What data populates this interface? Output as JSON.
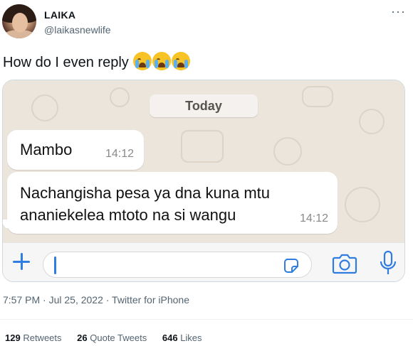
{
  "tweet": {
    "display_name": "LAIKA",
    "handle": "@laikasnewlife",
    "more_label": "···",
    "text": "How do I even reply",
    "emojis": [
      "loudly-crying-face",
      "loudly-crying-face",
      "loudly-crying-face"
    ],
    "meta": "7:57 PM · Jul 25, 2022 · Twitter for iPhone",
    "stats": {
      "retweets_count": "129",
      "retweets_label": "Retweets",
      "quotes_count": "26",
      "quotes_label": "Quote Tweets",
      "likes_count": "646",
      "likes_label": "Likes"
    }
  },
  "chat": {
    "date_label": "Today",
    "messages": [
      {
        "text": "Mambo",
        "time": "14:12"
      },
      {
        "line1": "Nachangisha pesa ya dna kuna mtu",
        "line2": "ananiekelea mtoto na si wangu",
        "time": "14:12"
      }
    ],
    "input_icons": [
      "plus-icon",
      "sticker-icon",
      "camera-icon",
      "microphone-icon"
    ]
  },
  "colors": {
    "chat_background": "#ece5dc",
    "accent_blue": "#2f7de1",
    "secondary_text": "#536471"
  }
}
